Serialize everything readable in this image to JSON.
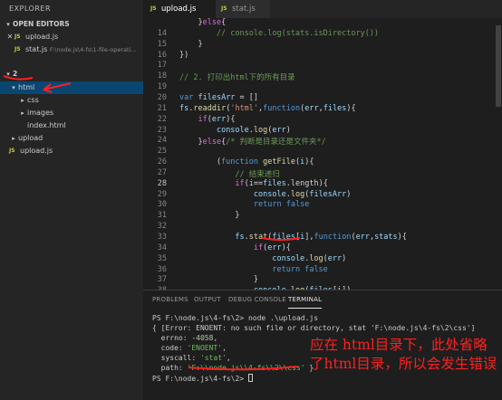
{
  "sidebar": {
    "title": "EXPLORER",
    "open_editors_label": "OPEN EDITORS",
    "open_editors": [
      {
        "icon": "JS",
        "name": "upload.js",
        "path": ""
      },
      {
        "icon": "JS",
        "name": "stat.js",
        "path": "F:\\node.js\\4-fs\\1-file-operati..."
      }
    ],
    "project_label": "2",
    "tree": [
      {
        "name": "html",
        "type": "folder",
        "expanded": true
      },
      {
        "name": "css",
        "type": "folder"
      },
      {
        "name": "images",
        "type": "folder"
      },
      {
        "name": "index.html",
        "type": "file"
      },
      {
        "name": "upload",
        "type": "folder"
      },
      {
        "name": "upload.js",
        "type": "js"
      }
    ]
  },
  "tabs": [
    {
      "icon": "JS",
      "label": "upload.js",
      "active": true
    },
    {
      "icon": "JS",
      "label": "stat.js",
      "active": false
    }
  ],
  "editor": {
    "current_line": 28,
    "lines": [
      {
        "n": "",
        "text": "    }else{"
      },
      {
        "n": "14",
        "text": "        // console.log(stats.isDirectory())"
      },
      {
        "n": "15",
        "text": "    }"
      },
      {
        "n": "16",
        "text": "})"
      },
      {
        "n": "17",
        "text": ""
      },
      {
        "n": "18",
        "text": "// 2. 打印出html下的所有目录"
      },
      {
        "n": "19",
        "text": ""
      },
      {
        "n": "20",
        "text": "var filesArr = []"
      },
      {
        "n": "21",
        "text": "fs.readdir('html',function(err,files){"
      },
      {
        "n": "22",
        "text": "    if(err){"
      },
      {
        "n": "23",
        "text": "        console.log(err)"
      },
      {
        "n": "24",
        "text": "    }else{/* 判断是目录还是文件夹*/"
      },
      {
        "n": "25",
        "text": ""
      },
      {
        "n": "26",
        "text": "        (function getFile(i){"
      },
      {
        "n": "27",
        "text": "            // 结束递归"
      },
      {
        "n": "28",
        "text": "            if(i==files.length){"
      },
      {
        "n": "29",
        "text": "                console.log(filesArr)"
      },
      {
        "n": "30",
        "text": "                return false"
      },
      {
        "n": "31",
        "text": "            }"
      },
      {
        "n": "32",
        "text": ""
      },
      {
        "n": "33",
        "text": "            fs.stat(files[i],function(err,stats){"
      },
      {
        "n": "34",
        "text": "                if(err){"
      },
      {
        "n": "35",
        "text": "                    console.log(err)"
      },
      {
        "n": "36",
        "text": "                    return false"
      },
      {
        "n": "37",
        "text": "                }"
      },
      {
        "n": "38",
        "text": "                console.log(files[i])"
      }
    ]
  },
  "panel": {
    "tabs": [
      "PROBLEMS",
      "OUTPUT",
      "DEBUG CONSOLE",
      "TERMINAL"
    ],
    "active_tab": "TERMINAL",
    "terminal": {
      "prompt1": "PS F:\\node.js\\4-fs\\2> ",
      "command": "node .\\upload.js",
      "error_line": "{ [Error: ENOENT: no such file or directory, stat 'F:\\node.js\\4-fs\\2\\css']",
      "errno_key": "  errno: ",
      "errno_val": "-4058",
      "code_key": "  code: ",
      "code_val": "'ENOENT'",
      "syscall_key": "  syscall: ",
      "syscall_val": "'stat'",
      "path_key": "  path: ",
      "path_val": "'F:\\\\node.js\\\\4-fs\\\\2\\\\css'",
      "path_end": " }",
      "prompt2": "PS F:\\node.js\\4-fs\\2> "
    }
  },
  "annotation": {
    "text": "应在 html目录下，此处省略了html目录，所以会发生错误",
    "color": "#ff2020"
  },
  "theme": {
    "sidebar_bg": "#252526",
    "editor_bg": "#1e1e1e",
    "selection": "#094771",
    "js_badge": "#cbcb41"
  }
}
